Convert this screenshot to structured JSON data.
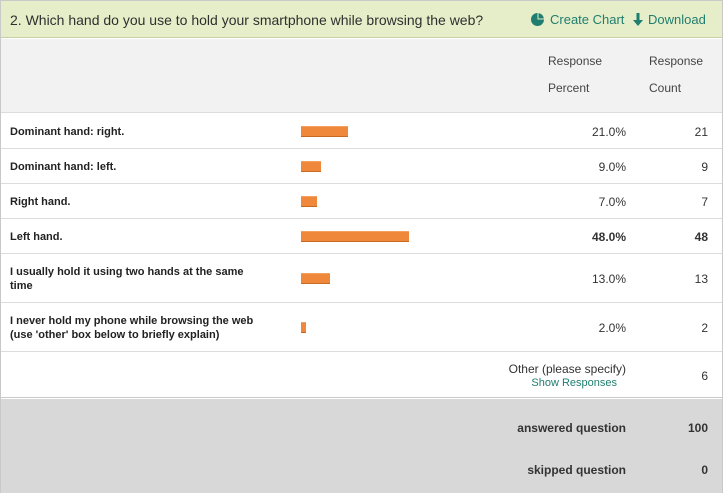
{
  "question": {
    "title": "2. Which hand do you use to hold your smartphone while browsing the web?",
    "create_chart_label": "Create Chart",
    "download_label": "Download"
  },
  "columns": {
    "percent_line1": "Response",
    "percent_line2": "Percent",
    "count_line1": "Response",
    "count_line2": "Count"
  },
  "answers": [
    {
      "label_line1": "Dominant hand: right.",
      "label_line2": "",
      "percent_text": "21.0%",
      "percent": 21.0,
      "count": "21",
      "bold": false
    },
    {
      "label_line1": "Dominant hand: left.",
      "label_line2": "",
      "percent_text": "9.0%",
      "percent": 9.0,
      "count": "9",
      "bold": false
    },
    {
      "label_line1": "Right hand.",
      "label_line2": "",
      "percent_text": "7.0%",
      "percent": 7.0,
      "count": "7",
      "bold": false
    },
    {
      "label_line1": "Left hand.",
      "label_line2": "",
      "percent_text": "48.0%",
      "percent": 48.0,
      "count": "48",
      "bold": true
    },
    {
      "label_line1": "I usually hold it using two hands at the same",
      "label_line2": "time",
      "percent_text": "13.0%",
      "percent": 13.0,
      "count": "13",
      "bold": false
    },
    {
      "label_line1": "I never hold my phone while browsing the web",
      "label_line2": "(use 'other' box below to briefly explain)",
      "percent_text": "2.0%",
      "percent": 2.0,
      "count": "2",
      "bold": false
    }
  ],
  "other": {
    "label": "Other (please specify)",
    "link": "Show Responses",
    "count": "6"
  },
  "summary": {
    "answered_label": "answered question",
    "answered_value": "100",
    "skipped_label": "skipped question",
    "skipped_value": "0"
  },
  "colors": {
    "bar": "#f0883b",
    "header_bg": "#e6eec9",
    "link": "#1f7e6f"
  },
  "icons": {
    "create_chart": "pie-chart-icon",
    "download": "download-arrow-icon"
  }
}
